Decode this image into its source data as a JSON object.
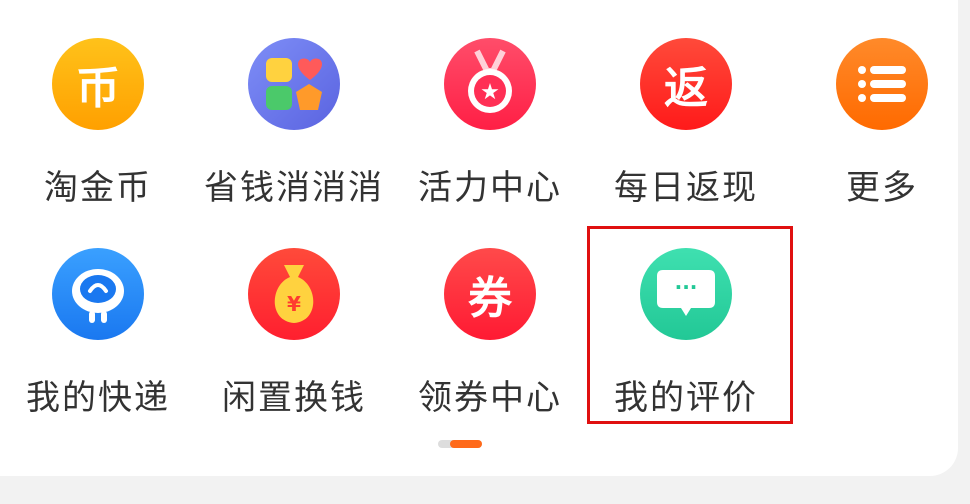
{
  "grid": {
    "row1": [
      {
        "label": "淘金币",
        "glyph": "币",
        "icon": "gold-coin-icon",
        "color": "#ffb100"
      },
      {
        "label": "省钱消消消",
        "glyph": "",
        "icon": "puzzle-blocks-icon",
        "color": "#6c7bf0"
      },
      {
        "label": "活力中心",
        "glyph": "★",
        "icon": "medal-star-icon",
        "color": "#ff2f55"
      },
      {
        "label": "每日返现",
        "glyph": "返",
        "icon": "cashback-icon",
        "color": "#ff2f2f"
      },
      {
        "label": "更多",
        "glyph": "",
        "icon": "more-list-icon",
        "color": "#ff7a1a"
      }
    ],
    "row2": [
      {
        "label": "我的快递",
        "glyph": "",
        "icon": "courier-mascot-icon",
        "color": "#2e8cff"
      },
      {
        "label": "闲置换钱",
        "glyph": "¥",
        "icon": "money-bag-icon",
        "color": "#ff3b2f"
      },
      {
        "label": "领券中心",
        "glyph": "券",
        "icon": "coupon-icon",
        "color": "#ff2f3f"
      },
      {
        "label": "我的评价",
        "glyph": "···",
        "icon": "chat-bubble-icon",
        "color": "#2fd7a4"
      }
    ]
  },
  "pager": {
    "pages": 2,
    "current": 2
  }
}
